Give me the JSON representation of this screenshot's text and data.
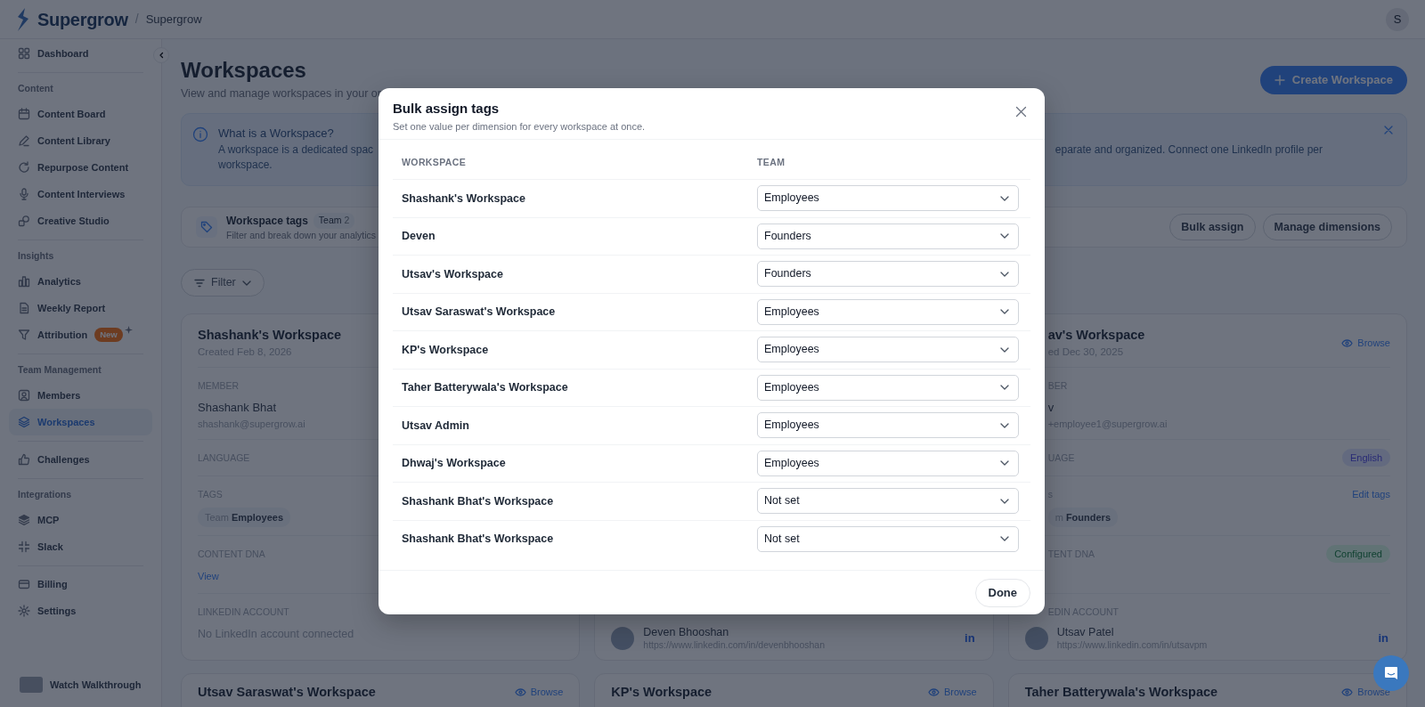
{
  "header": {
    "brand": "Supergrow",
    "separator": "/",
    "workspace": "Supergrow",
    "avatar": "S"
  },
  "sidebar": {
    "groups": [
      {
        "items": [
          {
            "label": "Dashboard",
            "selected": false
          }
        ]
      },
      {
        "heading": "Content",
        "items": [
          {
            "label": "Content Board",
            "selected": false
          },
          {
            "label": "Content Library",
            "selected": false
          },
          {
            "label": "Repurpose Content",
            "selected": false
          },
          {
            "label": "Content Interviews",
            "selected": false
          },
          {
            "label": "Creative Studio",
            "selected": false
          }
        ]
      },
      {
        "heading": "Insights",
        "items": [
          {
            "label": "Analytics",
            "selected": false
          },
          {
            "label": "Weekly Report",
            "selected": false
          },
          {
            "label": "Attribution",
            "selected": false,
            "badge": "New"
          }
        ]
      },
      {
        "heading": "Team Management",
        "items": [
          {
            "label": "Members",
            "selected": false
          },
          {
            "label": "Workspaces",
            "selected": true
          }
        ]
      },
      {
        "items": [
          {
            "label": "Challenges",
            "selected": false
          }
        ]
      },
      {
        "heading": "Integrations",
        "items": [
          {
            "label": "MCP",
            "selected": false
          },
          {
            "label": "Slack",
            "selected": false
          }
        ]
      },
      {
        "items": [
          {
            "label": "Billing",
            "selected": false
          },
          {
            "label": "Settings",
            "selected": false
          }
        ]
      }
    ],
    "walkthrough": "Watch Walkthrough"
  },
  "page": {
    "title": "Workspaces",
    "subtitle": "View and manage workspaces in your or",
    "create_button": "Create Workspace"
  },
  "info": {
    "title": "What is a Workspace?",
    "text_left": "A workspace is a dedicated spac",
    "text_right": "eparate and organized. Connect one LinkedIn profile per",
    "text_line2": "workspace."
  },
  "tags_bar": {
    "title": "Workspace tags",
    "badge_label": "Team",
    "badge_count": "2",
    "subtitle": "Filter and break down your analytics",
    "buttons": [
      "Bulk assign",
      "Manage dimensions"
    ]
  },
  "filter": "Filter",
  "cards": [
    {
      "kind": "full",
      "title": "Shashank's Workspace",
      "created": "Created Feb 8, 2026",
      "member_label": "MEMBER",
      "member_name": "Shashank Bhat",
      "member_email": "shashank@supergrow.ai",
      "language_label": "LANGUAGE",
      "tags_label": "TAGS",
      "tag": "Team **Employees**",
      "dna_label": "CONTENT DNA",
      "dna_link": "View",
      "linkedin_label": "LINKEDIN ACCOUNT",
      "linkedin_empty": "No LinkedIn account connected"
    },
    {
      "kind": "covered",
      "linkedin_name": "Deven Bhooshan",
      "linkedin_url": "https://www.linkedin.com/in/devenbhooshan",
      "linkedin_mark": "in"
    },
    {
      "kind": "clipped",
      "title": "av's Workspace",
      "created": "ed Dec 30, 2025",
      "browse": "Browse",
      "member_label": "BER",
      "member_name": "v",
      "member_email": "+employee1@supergrow.ai",
      "language_label": "UAGE",
      "language": "English",
      "tags_label": "s",
      "edit_tags": "Edit tags",
      "tag": "m **Founders**",
      "dna_label": "TENT DNA",
      "dna_status": "Configured",
      "linkedin_label": "EDIN ACCOUNT",
      "linkedin_name": "Utsav Patel",
      "linkedin_url": "https://www.linkedin.com/in/utsavpm",
      "linkedin_mark": "in"
    }
  ],
  "more_cards": [
    {
      "title": "Utsav Saraswat's Workspace",
      "browse": "Browse"
    },
    {
      "title": "KP's Workspace",
      "browse": "Browse"
    },
    {
      "title": "Taher Batterywala's Workspace",
      "browse": "Browse"
    }
  ],
  "modal": {
    "title": "Bulk assign tags",
    "subtitle": "Set one value per dimension for every workspace at once.",
    "columns": [
      "WORKSPACE",
      "TEAM"
    ],
    "rows": [
      {
        "workspace": "Shashank's Workspace",
        "team": "Employees"
      },
      {
        "workspace": "Deven",
        "team": "Founders"
      },
      {
        "workspace": "Utsav's Workspace",
        "team": "Founders"
      },
      {
        "workspace": "Utsav Saraswat's Workspace",
        "team": "Employees"
      },
      {
        "workspace": "KP's Workspace",
        "team": "Employees"
      },
      {
        "workspace": "Taher Batterywala's Workspace",
        "team": "Employees"
      },
      {
        "workspace": "Utsav Admin",
        "team": "Employees"
      },
      {
        "workspace": "Dhwaj's Workspace",
        "team": "Employees"
      },
      {
        "workspace": "Shashank Bhat's Workspace",
        "team": "Not set"
      },
      {
        "workspace": "Shashank Bhat's Workspace",
        "team": "Not set"
      }
    ],
    "done": "Done"
  }
}
